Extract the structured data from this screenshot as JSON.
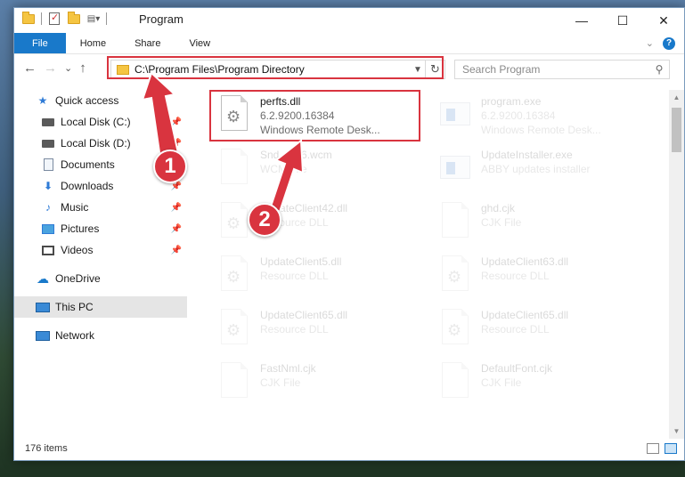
{
  "window": {
    "title": "Program",
    "minimize": "—",
    "maximize": "☐",
    "close": "✕"
  },
  "ribbon": {
    "tabs": [
      "File",
      "Home",
      "Share",
      "View"
    ],
    "expand_icon": "chevron-down-icon",
    "help_label": "?"
  },
  "nav": {
    "back": "←",
    "forward": "→",
    "recent": "⌄",
    "up": "↑",
    "address": "C:\\Program Files\\Program Directory",
    "refresh": "↻"
  },
  "search": {
    "placeholder": "Search Program"
  },
  "sidebar": {
    "items": [
      {
        "label": "Quick access",
        "icon": "star-icon"
      },
      {
        "label": "Local Disk (C:)",
        "icon": "disk-icon"
      },
      {
        "label": "Local Disk (D:)",
        "icon": "disk-icon"
      },
      {
        "label": "Documents",
        "icon": "documents-icon"
      },
      {
        "label": "Downloads",
        "icon": "download-icon"
      },
      {
        "label": "Music",
        "icon": "music-icon"
      },
      {
        "label": "Pictures",
        "icon": "pictures-icon"
      },
      {
        "label": "Videos",
        "icon": "videos-icon"
      },
      {
        "label": "OneDrive",
        "icon": "cloud-icon"
      },
      {
        "label": "This PC",
        "icon": "computer-icon"
      },
      {
        "label": "Network",
        "icon": "network-icon"
      }
    ]
  },
  "files": [
    {
      "name": "perfts.dll",
      "line1": "6.2.9200.16384",
      "line2": "Windows Remote Desk..."
    },
    {
      "name": "program.exe",
      "line1": "6.2.9200.16384",
      "line2": "Windows Remote Desk..."
    },
    {
      "name": "Snd...P16.wcm",
      "line1": "WCM File",
      "line2": ""
    },
    {
      "name": "UpdateInstaller.exe",
      "line1": "ABBY updates installer",
      "line2": ""
    },
    {
      "name": "UpdateClient42.dll",
      "line1": "Resource DLL",
      "line2": ""
    },
    {
      "name": "ghd.cjk",
      "line1": "CJK File",
      "line2": ""
    },
    {
      "name": "UpdateClient5.dll",
      "line1": "Resource DLL",
      "line2": ""
    },
    {
      "name": "UpdateClient63.dll",
      "line1": "Resource DLL",
      "line2": ""
    },
    {
      "name": "UpdateClient65.dll",
      "line1": "Resource DLL",
      "line2": ""
    },
    {
      "name": "UpdateClient65.dll",
      "line1": "Resource DLL",
      "line2": ""
    },
    {
      "name": "FastNml.cjk",
      "line1": "CJK File",
      "line2": ""
    },
    {
      "name": "DefaultFont.cjk",
      "line1": "CJK File",
      "line2": ""
    }
  ],
  "status": {
    "item_count": "176 items"
  },
  "callouts": [
    "1",
    "2"
  ],
  "colors": {
    "accent": "#1979ca",
    "highlight": "#d9343f"
  }
}
